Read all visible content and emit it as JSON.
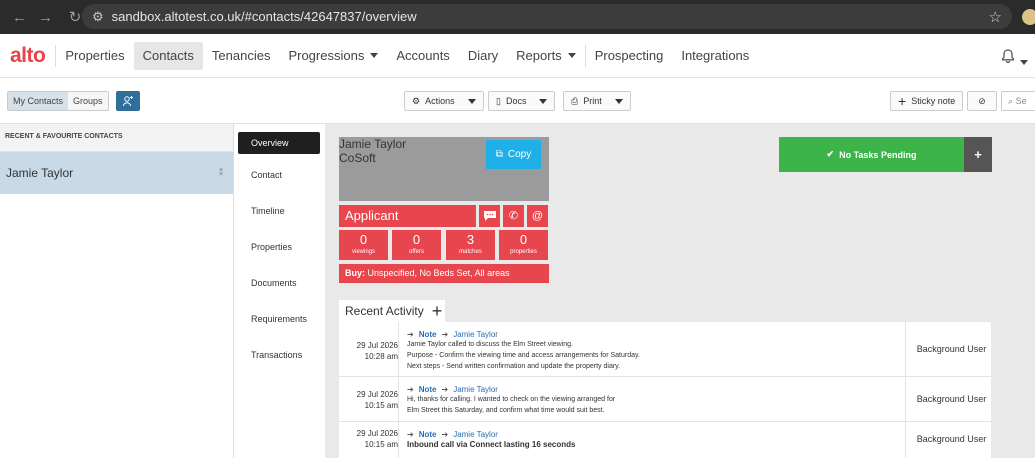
{
  "browser": {
    "url": "sandbox.altotest.co.uk/#contacts/42647837/overview",
    "back_icon": "←",
    "forward_icon": "→",
    "reload_icon": "↻",
    "site_icon": "⚙",
    "star_icon": "☆"
  },
  "app": {
    "logo": "alto",
    "nav": [
      "Properties",
      "Contacts",
      "Tenancies",
      "Progressions",
      "Accounts",
      "Diary",
      "Reports",
      "Prospecting",
      "Integrations"
    ]
  },
  "toolbar": {
    "my_contacts": "My Contacts",
    "groups": "Groups",
    "actions": "Actions",
    "docs": "Docs",
    "print": "Print",
    "sticky_note": "Sticky note",
    "search_placeholder": "Se"
  },
  "left_panel": {
    "header": "RECENT & FAVOURITE CONTACTS",
    "contact": "Jamie Taylor"
  },
  "tabs": [
    "Overview",
    "Contact",
    "Timeline",
    "Properties",
    "Documents",
    "Requirements",
    "Transactions"
  ],
  "contact_card": {
    "name": "Jamie Taylor",
    "company": "CoSoft",
    "copy_label": "Copy",
    "type": "Applicant",
    "stats": [
      {
        "value": "0",
        "label": "viewings"
      },
      {
        "value": "0",
        "label": "offers"
      },
      {
        "value": "3",
        "label": "matches"
      },
      {
        "value": "0",
        "label": "properties"
      }
    ],
    "buy_label": "Buy:",
    "buy_text": "Unspecified, No Beds Set, All areas"
  },
  "tasks": {
    "label": "No Tasks Pending",
    "plus": "+"
  },
  "recent_activity": {
    "title": "Recent Activity",
    "rows": [
      {
        "date": "29 Jul 2026",
        "time": "10:28 am",
        "type": "Note",
        "who": "Jamie Taylor",
        "lines": [
          "Jamie Taylor called to discuss the Elm Street viewing.",
          "Purpose - Confirm the viewing time and access arrangements for Saturday.",
          "Next steps - Send written confirmation and update the property diary."
        ],
        "user": "Background User"
      },
      {
        "date": "29 Jul 2026",
        "time": "10:15 am",
        "type": "Note",
        "who": "Jamie Taylor",
        "lines": [
          "Hi, thanks for calling. I wanted to check on the viewing arranged for",
          "Elm Street this Saturday, and confirm what time would suit best."
        ],
        "user": "Background User"
      },
      {
        "date": "29 Jul 2026",
        "time": "10:15 am",
        "type": "Note",
        "who": "Jamie Taylor",
        "lines": [
          "Inbound call via Connect lasting 16 seconds"
        ],
        "user": "Background User"
      }
    ]
  },
  "colors": {
    "brand_red": "#e8424a",
    "applicant_red": "#e8464e",
    "copy_blue": "#1fb0e8",
    "tasks_green": "#3cb44a",
    "link_blue": "#2a6fb5"
  }
}
